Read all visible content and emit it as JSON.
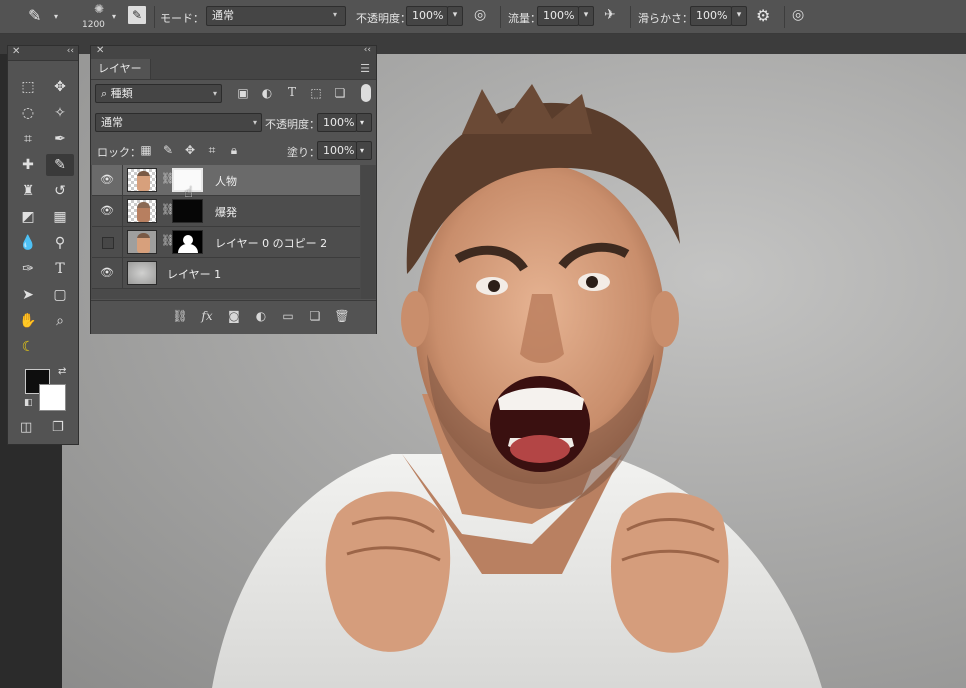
{
  "options_bar": {
    "brush_size": "1200",
    "mode_label": "モード：",
    "mode_value": "通常",
    "opacity_label": "不透明度：",
    "opacity_value": "100%",
    "flow_label": "流量：",
    "flow_value": "100%",
    "smoothing_label": "滑らかさ：",
    "smoothing_value": "100%"
  },
  "layers_panel": {
    "tab_label": "レイヤー",
    "filter_kind": "種類",
    "blend_mode": "通常",
    "opacity_label": "不透明度：",
    "opacity_value": "100%",
    "lock_label": "ロック：",
    "fill_label": "塗り：",
    "fill_value": "100%",
    "layers": [
      {
        "name": "人物",
        "visible": true,
        "selected": true,
        "mask": "white"
      },
      {
        "name": "爆発",
        "visible": true,
        "selected": false,
        "mask": "black"
      },
      {
        "name": "レイヤー 0 のコピー 2",
        "visible": false,
        "selected": false,
        "mask": "silhouette"
      },
      {
        "name": "レイヤー 1",
        "visible": true,
        "selected": false,
        "mask": "none"
      }
    ],
    "bottom_icons": [
      "link-icon",
      "fx-icon",
      "add-mask-icon",
      "adjustment-icon",
      "folder-icon",
      "new-layer-icon",
      "trash-icon"
    ]
  },
  "tools_panel": {
    "foreground_color": "#0e0e0e",
    "background_color": "#ffffff"
  }
}
